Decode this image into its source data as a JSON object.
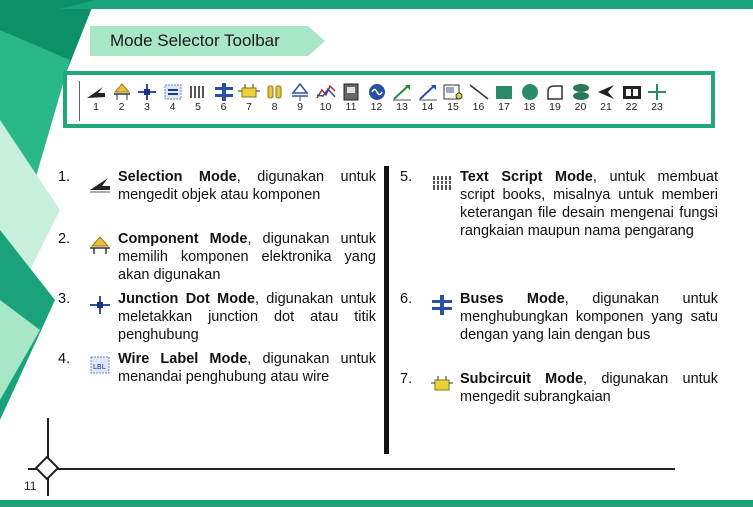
{
  "page": {
    "title": "Mode Selector Toolbar",
    "page_number": "11",
    "colors": {
      "accent": "#1aa37a",
      "banner": "#a8e6c8",
      "deco_dark": "#0d8f67",
      "deco_light": "#c8f0dc"
    }
  },
  "toolbar": {
    "tools": [
      {
        "num": "1",
        "icon": "selection-mode-icon"
      },
      {
        "num": "2",
        "icon": "component-mode-icon"
      },
      {
        "num": "3",
        "icon": "junction-dot-icon"
      },
      {
        "num": "4",
        "icon": "wire-label-icon"
      },
      {
        "num": "5",
        "icon": "text-script-icon"
      },
      {
        "num": "6",
        "icon": "buses-icon"
      },
      {
        "num": "7",
        "icon": "subcircuit-icon"
      },
      {
        "num": "8",
        "icon": "terminals-icon"
      },
      {
        "num": "9",
        "icon": "device-pins-icon"
      },
      {
        "num": "10",
        "icon": "graph-icon"
      },
      {
        "num": "11",
        "icon": "tape-recorder-icon"
      },
      {
        "num": "12",
        "icon": "generator-icon"
      },
      {
        "num": "13",
        "icon": "voltage-probe-icon"
      },
      {
        "num": "14",
        "icon": "current-probe-icon"
      },
      {
        "num": "15",
        "icon": "virtual-instruments-icon"
      },
      {
        "num": "16",
        "icon": "line-icon"
      },
      {
        "num": "17",
        "icon": "box-icon"
      },
      {
        "num": "18",
        "icon": "circle-icon"
      },
      {
        "num": "19",
        "icon": "arc-icon"
      },
      {
        "num": "20",
        "icon": "closed-path-icon"
      },
      {
        "num": "21",
        "icon": "text-icon"
      },
      {
        "num": "22",
        "icon": "symbol-icon"
      },
      {
        "num": "23",
        "icon": "marker-icon"
      }
    ]
  },
  "left_items": [
    {
      "n": "1.",
      "title": "Selection Mode",
      "rest": ", digunakan untuk mengedit objek atau komponen",
      "icon": "selection-mode-icon"
    },
    {
      "n": "2.",
      "title": "Component Mode",
      "rest": ", digunakan untuk memilih komponen elektronika yang akan digunakan",
      "icon": "component-mode-icon"
    },
    {
      "n": "3.",
      "title": "Junction Dot Mode",
      "rest": ", digunakan untuk meletakkan junction dot atau titik penghubung",
      "icon": "junction-dot-icon"
    },
    {
      "n": "4.",
      "title": "Wire Label Mode",
      "rest": ", digunakan untuk menandai penghubung atau wire",
      "icon": "wire-label-icon"
    }
  ],
  "right_items": [
    {
      "n": "5.",
      "title": "Text Script Mode",
      "rest": ", untuk membuat script books, misalnya untuk memberi keterangan file desain mengenai fungsi rangkaian maupun nama pengarang",
      "icon": "text-script-icon"
    },
    {
      "n": "6.",
      "title": "Buses Mode",
      "rest": ", digunakan untuk menghubungkan komponen yang satu dengan yang lain dengan bus",
      "icon": "buses-icon"
    },
    {
      "n": "7.",
      "title": "Subcircuit Mode",
      "rest": ", digunakan untuk mengedit subrangkaian",
      "icon": "subcircuit-icon"
    }
  ]
}
